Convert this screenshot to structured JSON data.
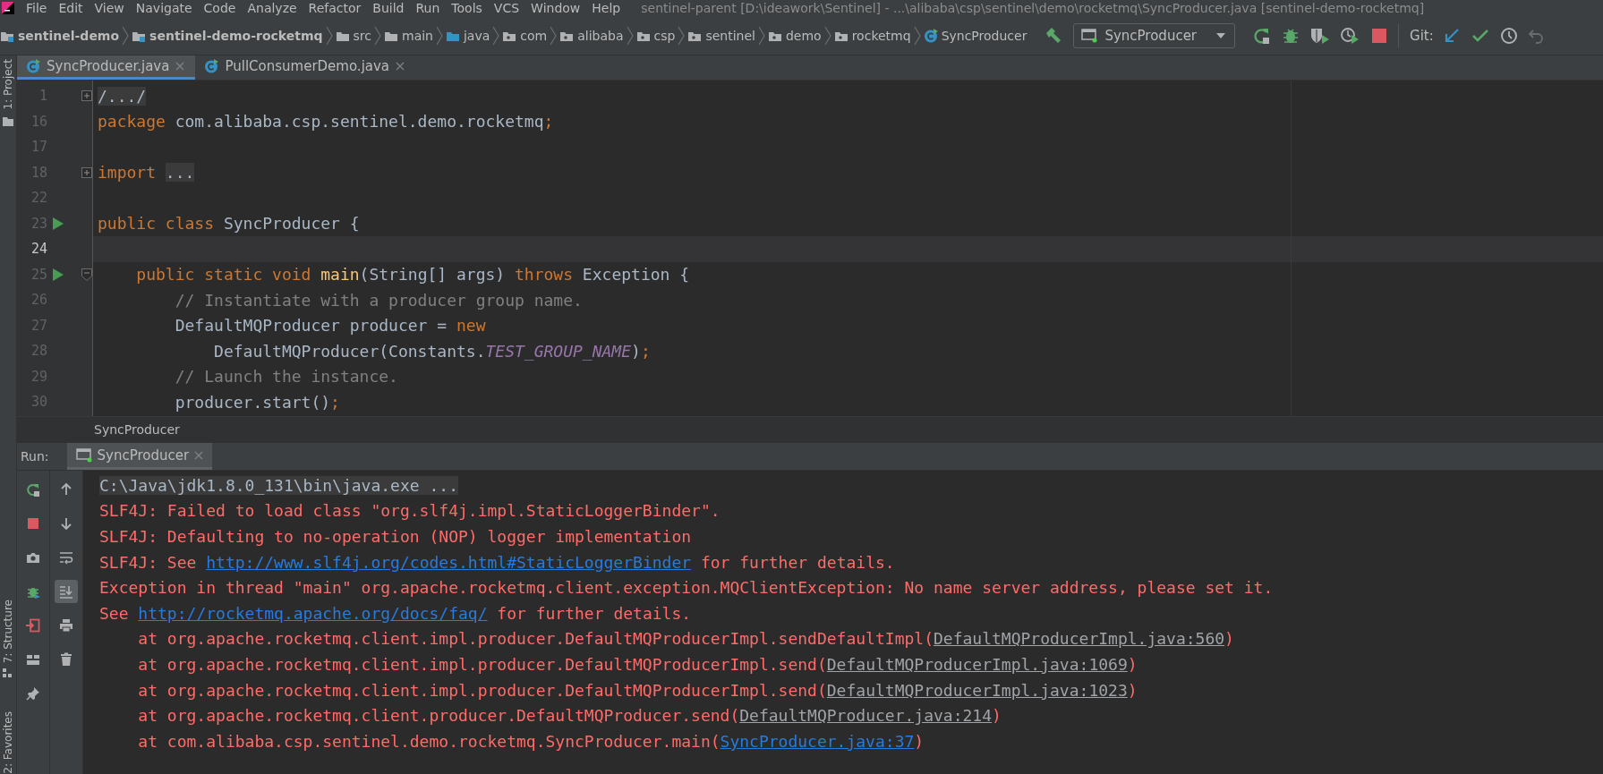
{
  "window": {
    "title": "sentinel-parent [D:\\ideawork\\Sentinel] - ...\\alibaba\\csp\\sentinel\\demo\\rocketmq\\SyncProducer.java [sentinel-demo-rocketmq]"
  },
  "menu": [
    "File",
    "Edit",
    "View",
    "Navigate",
    "Code",
    "Analyze",
    "Refactor",
    "Build",
    "Run",
    "Tools",
    "VCS",
    "Window",
    "Help"
  ],
  "breadcrumb": [
    {
      "label": "sentinel-demo",
      "kind": "module"
    },
    {
      "label": "sentinel-demo-rocketmq",
      "kind": "module"
    },
    {
      "label": "src",
      "kind": "folder"
    },
    {
      "label": "main",
      "kind": "folder"
    },
    {
      "label": "java",
      "kind": "source"
    },
    {
      "label": "com",
      "kind": "package"
    },
    {
      "label": "alibaba",
      "kind": "package"
    },
    {
      "label": "csp",
      "kind": "package"
    },
    {
      "label": "sentinel",
      "kind": "package"
    },
    {
      "label": "demo",
      "kind": "package"
    },
    {
      "label": "rocketmq",
      "kind": "package"
    },
    {
      "label": "SyncProducer",
      "kind": "class"
    }
  ],
  "run_config": {
    "label": "SyncProducer"
  },
  "git_label": "Git:",
  "side_tabs": [
    {
      "label": "1: Project"
    },
    {
      "label": "7: Structure"
    },
    {
      "label": "2: Favorites"
    }
  ],
  "editor_tabs": [
    {
      "label": "SyncProducer.java",
      "selected": true
    },
    {
      "label": "PullConsumerDemo.java",
      "selected": false
    }
  ],
  "code_lines": [
    {
      "number": "1",
      "run": false,
      "fold_marker": true,
      "collapsed": true,
      "current": false,
      "tokens": [
        {
          "kind": "folded",
          "text": "/.../"
        }
      ]
    },
    {
      "number": "16",
      "run": false,
      "fold_marker": false,
      "current": false,
      "tokens": [
        {
          "kind": "keyword",
          "text": "package"
        },
        {
          "kind": "plain",
          "text": " com.alibaba.csp.sentinel.demo.rocketmq"
        },
        {
          "kind": "keyword",
          "text": ";"
        }
      ]
    },
    {
      "number": "17",
      "run": false,
      "fold_marker": false,
      "current": false
    },
    {
      "number": "18",
      "run": false,
      "fold_marker": true,
      "collapsed": true,
      "current": false,
      "tokens": [
        {
          "kind": "keyword",
          "text": "import "
        },
        {
          "kind": "folded",
          "text": "..."
        }
      ]
    },
    {
      "number": "22",
      "run": false,
      "fold_marker": false,
      "current": false
    },
    {
      "number": "23",
      "run": true,
      "fold_marker": false,
      "current": false,
      "tokens": [
        {
          "kind": "keyword",
          "text": "public class"
        },
        {
          "kind": "plain",
          "text": " SyncProducer {"
        }
      ]
    },
    {
      "number": "24",
      "run": false,
      "fold_marker": false,
      "current": true
    },
    {
      "number": "25",
      "run": true,
      "fold_marker": true,
      "collapsed": false,
      "current": false,
      "tokens": [
        {
          "kind": "keyword",
          "text": "    public static void "
        },
        {
          "kind": "method",
          "text": "main"
        },
        {
          "kind": "plain",
          "text": "(String[] args) "
        },
        {
          "kind": "keyword",
          "text": "throws"
        },
        {
          "kind": "plain",
          "text": " Exception {"
        }
      ]
    },
    {
      "number": "26",
      "run": false,
      "fold_marker": false,
      "current": false,
      "tokens": [
        {
          "kind": "comment",
          "text": "        // Instantiate with a producer group name."
        }
      ]
    },
    {
      "number": "27",
      "run": false,
      "fold_marker": false,
      "current": false,
      "tokens": [
        {
          "kind": "plain",
          "text": "        DefaultMQProducer producer = "
        },
        {
          "kind": "keyword",
          "text": "new"
        }
      ]
    },
    {
      "number": "28",
      "run": false,
      "fold_marker": false,
      "current": false,
      "tokens": [
        {
          "kind": "plain",
          "text": "            DefaultMQProducer(Constants."
        },
        {
          "kind": "constant",
          "text": "TEST_GROUP_NAME"
        },
        {
          "kind": "plain",
          "text": ")"
        },
        {
          "kind": "keyword",
          "text": ";"
        }
      ]
    },
    {
      "number": "29",
      "run": false,
      "fold_marker": false,
      "current": false,
      "tokens": [
        {
          "kind": "comment",
          "text": "        // Launch the instance."
        }
      ]
    },
    {
      "number": "30",
      "run": false,
      "fold_marker": false,
      "current": false,
      "tokens": [
        {
          "kind": "plain",
          "text": "        producer.start()"
        },
        {
          "kind": "keyword",
          "text": ";"
        }
      ]
    }
  ],
  "editor_breadcrumb": "SyncProducer",
  "run_panel": {
    "label": "Run:",
    "tabs": [
      {
        "label": "SyncProducer",
        "selected": true
      }
    ],
    "tools_left": [
      {
        "kind": "rerun",
        "selected": false
      },
      {
        "kind": "stop",
        "selected": false
      },
      {
        "kind": "camera",
        "selected": false
      },
      {
        "kind": "debug",
        "selected": false
      },
      {
        "kind": "exit",
        "selected": false
      },
      {
        "kind": "layout",
        "selected": false
      },
      {
        "kind": "pin",
        "selected": false
      }
    ],
    "tools_right": [
      {
        "kind": "up",
        "selected": false
      },
      {
        "kind": "down",
        "selected": false
      },
      {
        "kind": "wrap",
        "selected": false
      },
      {
        "kind": "scroll_end",
        "selected": true
      },
      {
        "kind": "print",
        "selected": false
      },
      {
        "kind": "trash",
        "selected": false
      }
    ],
    "console": [
      {
        "kind": "command",
        "segments": [
          {
            "kind": "text",
            "text": "C:\\Java\\jdk1.8.0_131\\bin\\java.exe ..."
          }
        ]
      },
      {
        "kind": "error",
        "segments": [
          {
            "kind": "text",
            "text": "SLF4J: Failed to load class \"org.slf4j.impl.StaticLoggerBinder\"."
          }
        ]
      },
      {
        "kind": "error",
        "segments": [
          {
            "kind": "text",
            "text": "SLF4J: Defaulting to no-operation (NOP) logger implementation"
          }
        ]
      },
      {
        "kind": "error",
        "segments": [
          {
            "kind": "text",
            "text": "SLF4J: See "
          },
          {
            "kind": "link",
            "text": "http://www.slf4j.org/codes.html#StaticLoggerBinder"
          },
          {
            "kind": "text",
            "text": " for further details."
          }
        ]
      },
      {
        "kind": "error",
        "segments": [
          {
            "kind": "text",
            "text": "Exception in thread \"main\" org.apache.rocketmq.client.exception.MQClientException: No name server address, please set it."
          }
        ]
      },
      {
        "kind": "error",
        "segments": [
          {
            "kind": "text",
            "text": "See "
          },
          {
            "kind": "link",
            "text": "http://rocketmq.apache.org/docs/faq/"
          },
          {
            "kind": "text",
            "text": " for further details."
          }
        ]
      },
      {
        "kind": "error",
        "segments": [
          {
            "kind": "text",
            "text": "    at org.apache.rocketmq.client.impl.producer.DefaultMQProducerImpl.sendDefaultImpl("
          },
          {
            "kind": "source",
            "text": "DefaultMQProducerImpl.java:560"
          },
          {
            "kind": "text",
            "text": ")"
          }
        ]
      },
      {
        "kind": "error",
        "segments": [
          {
            "kind": "text",
            "text": "    at org.apache.rocketmq.client.impl.producer.DefaultMQProducerImpl.send("
          },
          {
            "kind": "source",
            "text": "DefaultMQProducerImpl.java:1069"
          },
          {
            "kind": "text",
            "text": ")"
          }
        ]
      },
      {
        "kind": "error",
        "segments": [
          {
            "kind": "text",
            "text": "    at org.apache.rocketmq.client.impl.producer.DefaultMQProducerImpl.send("
          },
          {
            "kind": "source",
            "text": "DefaultMQProducerImpl.java:1023"
          },
          {
            "kind": "text",
            "text": ")"
          }
        ]
      },
      {
        "kind": "error",
        "segments": [
          {
            "kind": "text",
            "text": "    at org.apache.rocketmq.client.producer.DefaultMQProducer.send("
          },
          {
            "kind": "source",
            "text": "DefaultMQProducer.java:214"
          },
          {
            "kind": "text",
            "text": ")"
          }
        ]
      },
      {
        "kind": "error",
        "segments": [
          {
            "kind": "text",
            "text": "    at com.alibaba.csp.sentinel.demo.rocketmq.SyncProducer.main("
          },
          {
            "kind": "link",
            "text": "SyncProducer.java:37"
          },
          {
            "kind": "text",
            "text": ")"
          }
        ]
      }
    ]
  }
}
